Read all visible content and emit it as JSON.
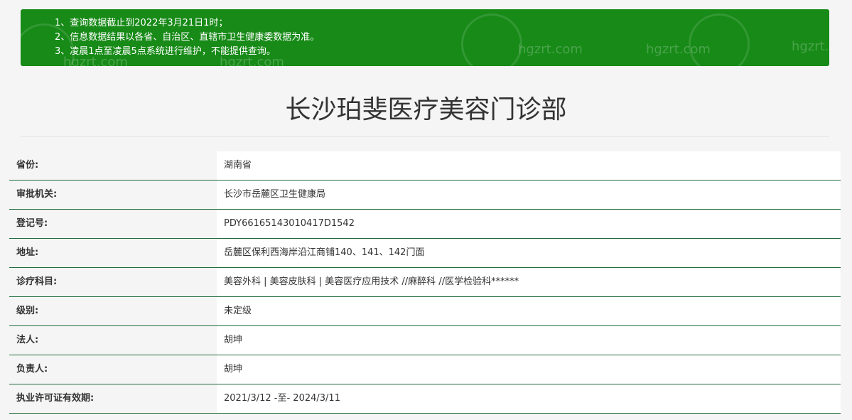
{
  "notice": {
    "lines": [
      "1、查询数据截止到2022年3月21日1时；",
      "2、信息数据结果以各省、自治区、直辖市卫生健康委数据为准。",
      "3、凌晨1点至凌晨5点系统进行维护，不能提供查询。"
    ],
    "watermark": "hgzrt.com",
    "background_color": "#178a17"
  },
  "title": "长沙珀斐医疗美容门诊部",
  "rows": [
    {
      "label": "省份:",
      "value": "湖南省"
    },
    {
      "label": "审批机关:",
      "value": "长沙市岳麓区卫生健康局"
    },
    {
      "label": "登记号:",
      "value": "PDY66165143010417D1542"
    },
    {
      "label": "地址:",
      "value": "岳麓区保利西海岸沿江商铺140、141、142门面"
    },
    {
      "label": "诊疗科目:",
      "value": "美容外科 | 美容皮肤科 | 美容医疗应用技术 //麻醉科 //医学检验科******"
    },
    {
      "label": "级别:",
      "value": "未定级"
    },
    {
      "label": "法人:",
      "value": "胡坤"
    },
    {
      "label": "负责人:",
      "value": "胡坤"
    },
    {
      "label": "执业许可证有效期:",
      "value": "2021/3/12 -至- 2024/3/11"
    }
  ],
  "colors": {
    "row_divider": "#1f6b3a",
    "page_background": "#f5f5f5"
  }
}
